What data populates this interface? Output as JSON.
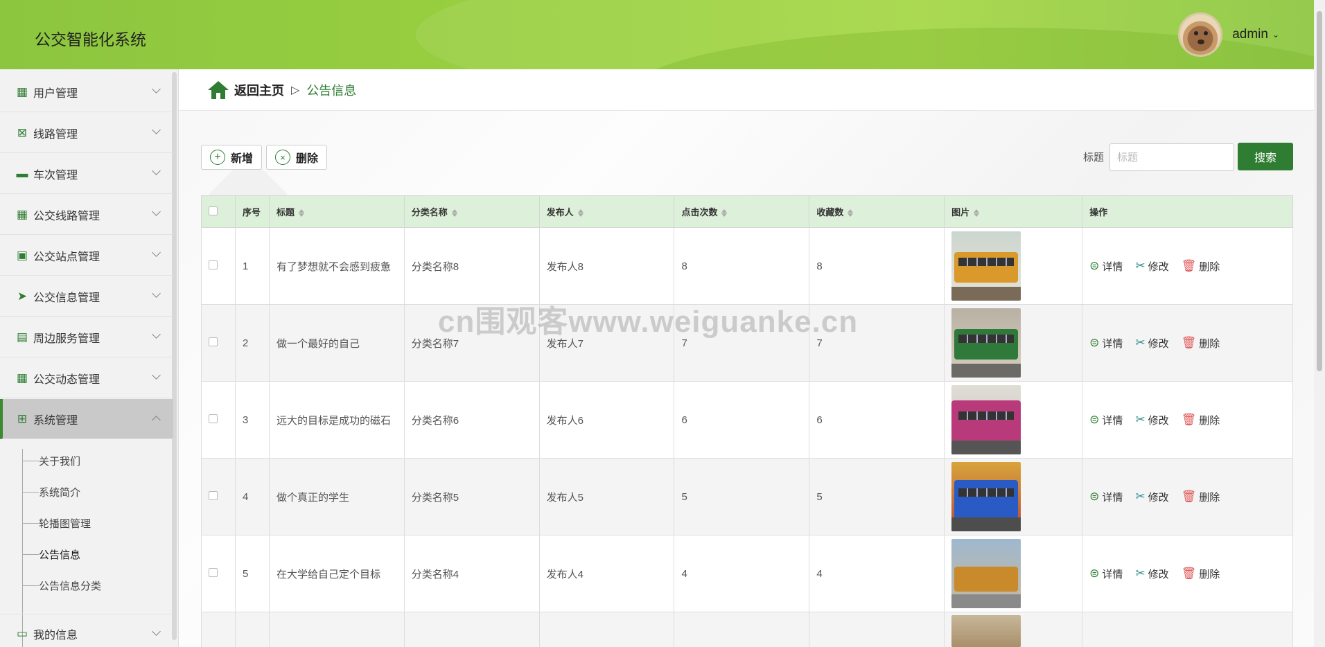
{
  "header": {
    "app_title": "公交智能化系统",
    "user_name": "admin"
  },
  "sidebar": {
    "items": [
      {
        "label": "用户管理",
        "icon": "grid-icon"
      },
      {
        "label": "线路管理",
        "icon": "clipboard-x-icon"
      },
      {
        "label": "车次管理",
        "icon": "ticket-icon"
      },
      {
        "label": "公交线路管理",
        "icon": "grid-icon"
      },
      {
        "label": "公交站点管理",
        "icon": "briefcase-icon"
      },
      {
        "label": "公交信息管理",
        "icon": "send-icon"
      },
      {
        "label": "周边服务管理",
        "icon": "clipboard-icon"
      },
      {
        "label": "公交动态管理",
        "icon": "grid-icon"
      },
      {
        "label": "系统管理",
        "icon": "apps-icon"
      },
      {
        "label": "我的信息",
        "icon": "card-icon"
      }
    ],
    "sub_items": [
      "关于我们",
      "系统简介",
      "轮播图管理",
      "公告信息",
      "公告信息分类"
    ],
    "active_sub": "公告信息"
  },
  "breadcrumb": {
    "home": "返回主页",
    "separator": "▷",
    "current": "公告信息"
  },
  "toolbar": {
    "add_label": "新增",
    "delete_label": "删除",
    "search_label": "标题",
    "search_placeholder": "标题",
    "search_button": "搜索"
  },
  "table": {
    "columns": [
      "序号",
      "标题",
      "分类名称",
      "发布人",
      "点击次数",
      "收藏数",
      "图片",
      "操作"
    ],
    "rows": [
      {
        "index": "1",
        "title": "有了梦想就不会感到疲惫",
        "category": "分类名称8",
        "publisher": "发布人8",
        "clicks": "8",
        "favorites": "8"
      },
      {
        "index": "2",
        "title": "做一个最好的自己",
        "category": "分类名称7",
        "publisher": "发布人7",
        "clicks": "7",
        "favorites": "7"
      },
      {
        "index": "3",
        "title": "远大的目标是成功的磁石",
        "category": "分类名称6",
        "publisher": "发布人6",
        "clicks": "6",
        "favorites": "6"
      },
      {
        "index": "4",
        "title": "做个真正的学生",
        "category": "分类名称5",
        "publisher": "发布人5",
        "clicks": "5",
        "favorites": "5"
      },
      {
        "index": "5",
        "title": "在大学给自己定个目标",
        "category": "分类名称4",
        "publisher": "发布人4",
        "clicks": "4",
        "favorites": "4"
      }
    ],
    "actions": {
      "detail": "详情",
      "edit": "修改",
      "delete": "删除"
    }
  },
  "watermark": "cn围观客www.weiguanke.cn",
  "colors": {
    "accent": "#2e7d32",
    "header": "#9bd141",
    "table_header": "#ddf0d9"
  }
}
